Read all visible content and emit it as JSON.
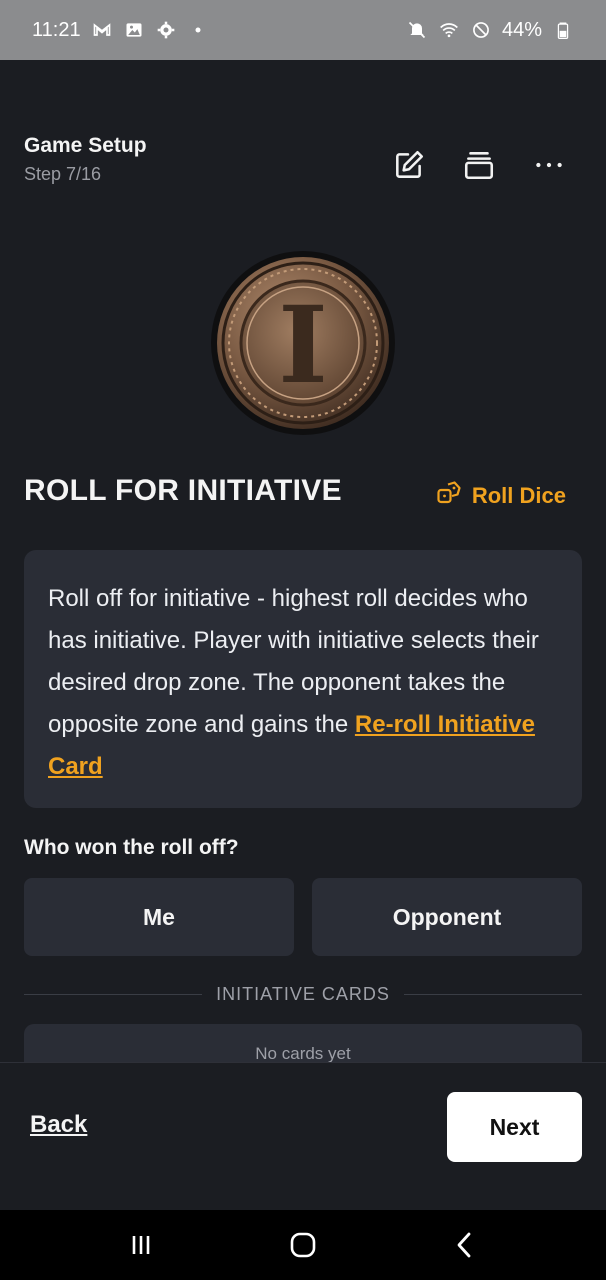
{
  "status_bar": {
    "time": "11:21",
    "left_icons": [
      "gmail-icon",
      "gallery-icon",
      "settings-gear-icon",
      "notification-dot-icon"
    ],
    "right_icons": [
      "mute-icon",
      "wifi-icon",
      "do-not-disturb-icon",
      "battery-icon"
    ],
    "battery": "44%"
  },
  "header": {
    "title": "Game Setup",
    "step": "Step 7/16",
    "actions": [
      "edit-icon",
      "stack-icon",
      "more-icon"
    ]
  },
  "hero": {
    "coin_icon": "initiative-coin-icon",
    "coin_letter": "I"
  },
  "section": {
    "title": "ROLL FOR INITIATIVE",
    "roll_dice_label": "Roll Dice",
    "roll_dice_icon": "dice-icon"
  },
  "description": {
    "text": "Roll off for initiative - highest roll decides who has initiative. Player with initiative selects their desired drop zone. The opponent takes the opposite zone and gains the ",
    "link": "Re-roll Initiative Card"
  },
  "question": {
    "label": "Who won the roll off?",
    "options": [
      "Me",
      "Opponent"
    ]
  },
  "initiative_cards": {
    "heading": "INITIATIVE CARDS",
    "empty_text": "No cards yet"
  },
  "footer": {
    "back_label": "Back",
    "next_label": "Next"
  },
  "colors": {
    "background": "#1b1d22",
    "card": "#2a2d36",
    "accent": "#f0a21f",
    "status_bar": "#8b8c8e"
  },
  "nav_bar": {
    "buttons": [
      "recent-apps-icon",
      "home-icon",
      "back-icon"
    ]
  }
}
